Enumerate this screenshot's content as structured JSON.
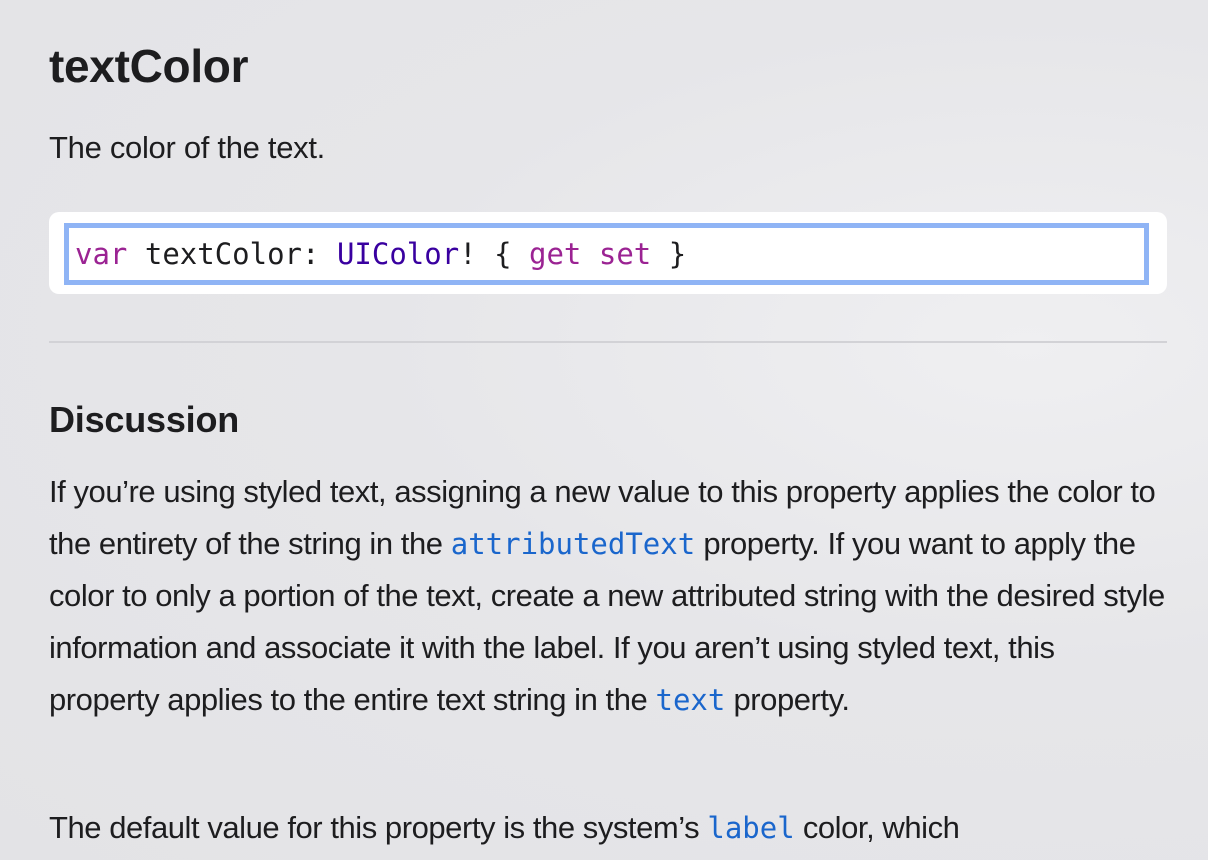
{
  "title": "textColor",
  "abstract": "The color of the text.",
  "declaration": {
    "keyword_var": "var",
    "name": "textColor",
    "colon": ":",
    "type": "UIColor",
    "suffix": "! {",
    "keyword_get": "get",
    "keyword_set": "set",
    "close": "}"
  },
  "discussion": {
    "heading": "Discussion",
    "paragraph1": {
      "text_before_link1": "If you’re using styled text, assigning a new value to this property applies the color to the entirety of the string in the",
      "link1": "attributedText",
      "text_between_links": "property. If you want to apply the color to only a portion of the text, create a new attributed string with the desired style information and associate it with the label. If you aren’t using styled text, this property applies to the entire text string in the",
      "link2": "text",
      "text_after_link2": "property."
    },
    "paragraph2": {
      "text_before_link": "The default value for this property is the system’s",
      "link": "label",
      "text_after_link": "color, which"
    }
  },
  "colors": {
    "keyword": "#9b2393",
    "type": "#3900a0",
    "link": "#1a66cc",
    "focus_ring": "#8fb4f5"
  }
}
